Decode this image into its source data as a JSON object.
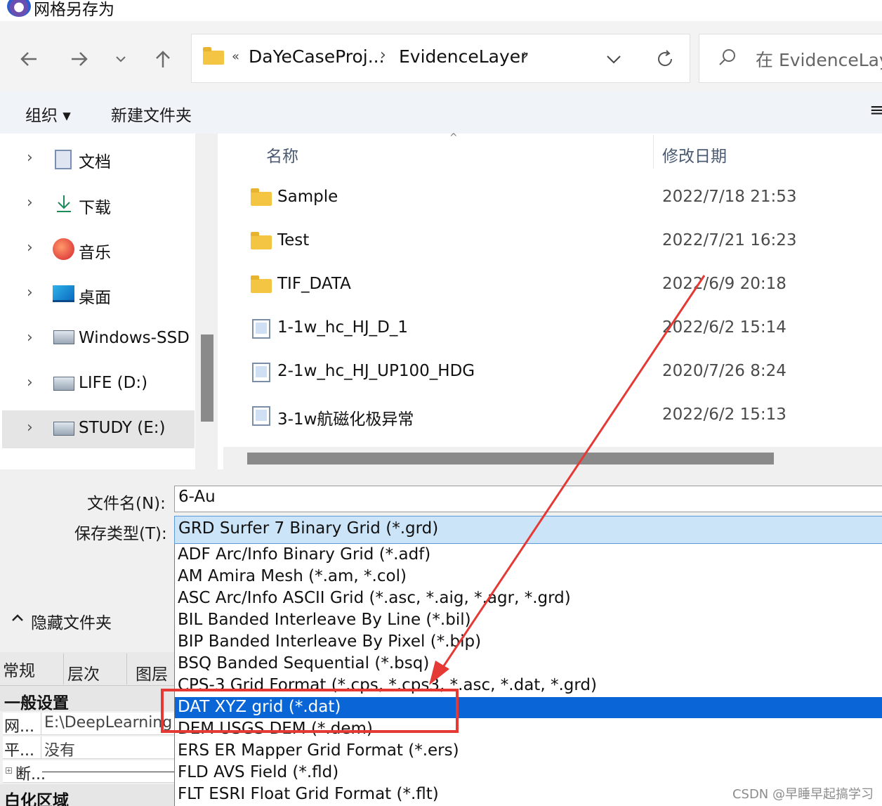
{
  "window": {
    "title": "网格另存为"
  },
  "nav": {
    "back_icon": "arrow-left-icon",
    "forward_icon": "arrow-right-icon",
    "recent_icon": "chevron-down-icon",
    "up_icon": "arrow-up-icon"
  },
  "address": {
    "overflow": "«",
    "crumbs": [
      "DaYeCaseProj...",
      "EvidenceLayer"
    ],
    "separator": "›"
  },
  "search": {
    "placeholder": "在 EvidenceLaye"
  },
  "toolbar": {
    "organize": "组织 ▾",
    "new_folder": "新建文件夹",
    "menu_icon": "≡"
  },
  "sidebar": {
    "items": [
      {
        "label": "文档",
        "icon": "documents-icon",
        "selected": false
      },
      {
        "label": "下载",
        "icon": "download-icon",
        "selected": false
      },
      {
        "label": "音乐",
        "icon": "music-icon",
        "selected": false
      },
      {
        "label": "桌面",
        "icon": "desktop-icon",
        "selected": false
      },
      {
        "label": "Windows-SSD",
        "icon": "drive-icon",
        "selected": false
      },
      {
        "label": "LIFE (D:)",
        "icon": "drive-icon",
        "selected": false
      },
      {
        "label": "STUDY (E:)",
        "icon": "drive-icon",
        "selected": true
      }
    ]
  },
  "filelist": {
    "columns": {
      "name": "名称",
      "date": "修改日期"
    },
    "rows": [
      {
        "name": "Sample",
        "date": "2022/7/18 21:53",
        "type": "folder"
      },
      {
        "name": "Test",
        "date": "2022/7/21 16:23",
        "type": "folder"
      },
      {
        "name": "TIF_DATA",
        "date": "2022/6/9 20:18",
        "type": "folder"
      },
      {
        "name": "1-1w_hc_HJ_D_1",
        "date": "2022/6/2 15:14",
        "type": "grid"
      },
      {
        "name": "2-1w_hc_HJ_UP100_HDG",
        "date": "2020/7/26 8:24",
        "type": "grid"
      },
      {
        "name": "3-1w航磁化极异常",
        "date": "2022/6/2 15:13",
        "type": "grid"
      }
    ]
  },
  "form": {
    "filename_label": "文件名(N):",
    "filename_value": "6-Au",
    "type_label": "保存类型(T):",
    "type_value": "GRD Surfer 7 Binary Grid (*.grd)"
  },
  "hide_folders": "隐藏文件夹",
  "dropdown": {
    "items": [
      "ADF Arc/Info Binary Grid (*.adf)",
      "AM  Amira Mesh (*.am, *.col)",
      "ASC Arc/Info ASCII Grid (*.asc, *.aig, *.agr, *.grd)",
      "BIL Banded Interleave By Line (*.bil)",
      "BIP Banded Interleave By Pixel (*.bip)",
      "BSQ Banded Sequential (*.bsq)",
      "CPS-3 Grid Format (*.cps, *.cps3, *.asc, *.dat, *.grd)",
      "DAT XYZ grid (*.dat)",
      "DEM USGS DEM (*.dem)",
      "ERS ER Mapper Grid Format (*.ers)",
      "FLD AVS Field (*.fld)",
      "FLT ESRI Float Grid Format (*.flt)"
    ],
    "selected_index": 7
  },
  "property_panel": {
    "tabs": [
      "常规",
      "层次",
      "图层"
    ],
    "section1": "一般设置",
    "rows": [
      {
        "key": "网...",
        "value": "E:\\DeepLearning"
      },
      {
        "key": "平...",
        "value": "没有"
      },
      {
        "key": "断...",
        "value": ""
      }
    ],
    "section2": "白化区域"
  },
  "annotation": {
    "color": "#e53935"
  },
  "watermark": "CSDN @早睡早起搞学习"
}
